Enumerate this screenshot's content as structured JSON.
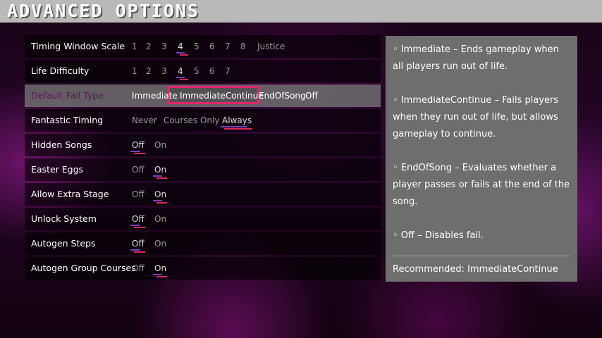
{
  "screen": {
    "title": "ADVANCED OPTIONS"
  },
  "colors": {
    "player1_underline": "#7c3cc4",
    "player2_underline": "#e0265a",
    "cursor": "#e0266e",
    "header_bg": "#b9b9b9"
  },
  "options": [
    {
      "label": "Timing Window Scale",
      "choices": [
        "1",
        "2",
        "3",
        "4",
        "5",
        "6",
        "7",
        "8",
        "Justice"
      ],
      "p1": 3,
      "p2": 3
    },
    {
      "label": "Life Difficulty",
      "choices": [
        "1",
        "2",
        "3",
        "4",
        "5",
        "6",
        "7"
      ],
      "p1": 3,
      "p2": 3
    },
    {
      "label": "Default Fail Type",
      "choices": [
        "Immediate",
        "ImmediateContinue",
        "EndOfSong",
        "Off"
      ],
      "focused": 1,
      "active": true
    },
    {
      "label": "Fantastic Timing",
      "choices": [
        "Never",
        "Courses Only",
        "Always"
      ],
      "p1": 2,
      "p2": 2
    },
    {
      "label": "Hidden Songs",
      "choices": [
        "Off",
        "On"
      ],
      "p1": 0,
      "p2": 0
    },
    {
      "label": "Easter Eggs",
      "choices": [
        "Off",
        "On"
      ],
      "p1": 1,
      "p2": 1
    },
    {
      "label": "Allow Extra Stage",
      "choices": [
        "Off",
        "On"
      ],
      "p1": 1,
      "p2": 1
    },
    {
      "label": "Unlock System",
      "choices": [
        "Off",
        "On"
      ],
      "p1": 0,
      "p2": 0
    },
    {
      "label": "Autogen Steps",
      "choices": [
        "Off",
        "On"
      ],
      "p1": 0,
      "p2": 0
    },
    {
      "label": "Autogen Group Courses",
      "choices": [
        "Off",
        "On"
      ],
      "p1": 1,
      "p2": 1
    }
  ],
  "description": {
    "paragraphs": [
      "◦ Immediate – Ends gameplay when all players run out of life.",
      "◦ ImmediateContinue – Fails players when they run out of life, but allows gameplay to continue.",
      "◦ EndOfSong – Evaluates whether a player passes or fails at the end of the song.",
      "◦ Off – Disables fail."
    ],
    "recommended": "Recommended: ImmediateContinue"
  }
}
